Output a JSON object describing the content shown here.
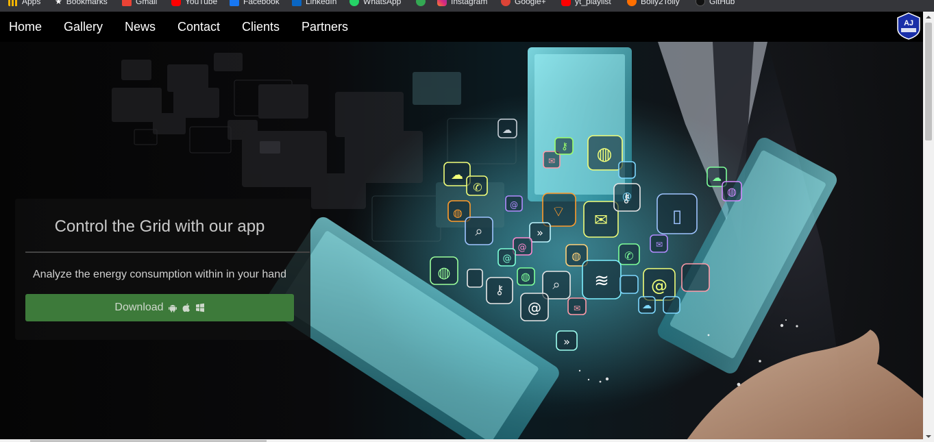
{
  "bookmarks": {
    "items": [
      {
        "label": "Apps",
        "icon": "apps-grid-icon",
        "color": "#f4b400"
      },
      {
        "label": "Bookmarks",
        "icon": "star-icon",
        "color": "#ffffff"
      },
      {
        "label": "Gmail",
        "icon": "gmail-icon",
        "color": "#ea4335"
      },
      {
        "label": "YouTube",
        "icon": "youtube-icon",
        "color": "#ff0000"
      },
      {
        "label": "Facebook",
        "icon": "facebook-icon",
        "color": "#1877f2"
      },
      {
        "label": "LinkedIn",
        "icon": "linkedin-icon",
        "color": "#0a66c2"
      },
      {
        "label": "WhatsApp",
        "icon": "whatsapp-icon",
        "color": "#25d366"
      },
      {
        "label": "",
        "icon": "green-circle-icon",
        "color": "#34a853"
      },
      {
        "label": "Instagram",
        "icon": "instagram-icon",
        "color": "#e1306c"
      },
      {
        "label": "Google+",
        "icon": "google-plus-icon",
        "color": "#db4437"
      },
      {
        "label": "yt_playlist",
        "icon": "youtube-icon",
        "color": "#ff0000"
      },
      {
        "label": "Bolly2Tolly",
        "icon": "bolly-icon",
        "color": "#ff6f00"
      },
      {
        "label": "GitHub",
        "icon": "github-icon",
        "color": "#24292e"
      }
    ]
  },
  "nav": {
    "links": [
      "Home",
      "Gallery",
      "News",
      "Contact",
      "Clients",
      "Partners"
    ],
    "logo_text": "AJ"
  },
  "hero": {
    "title": "Control the Grid with our app",
    "subtitle": "Analyze the energy consumption within in your hand",
    "download_label": "Download",
    "os_icons": [
      "android-icon",
      "apple-icon",
      "windows-icon"
    ]
  },
  "colors": {
    "accent_green": "#3d7a3a",
    "glow_cyan": "#7ff0ff"
  }
}
